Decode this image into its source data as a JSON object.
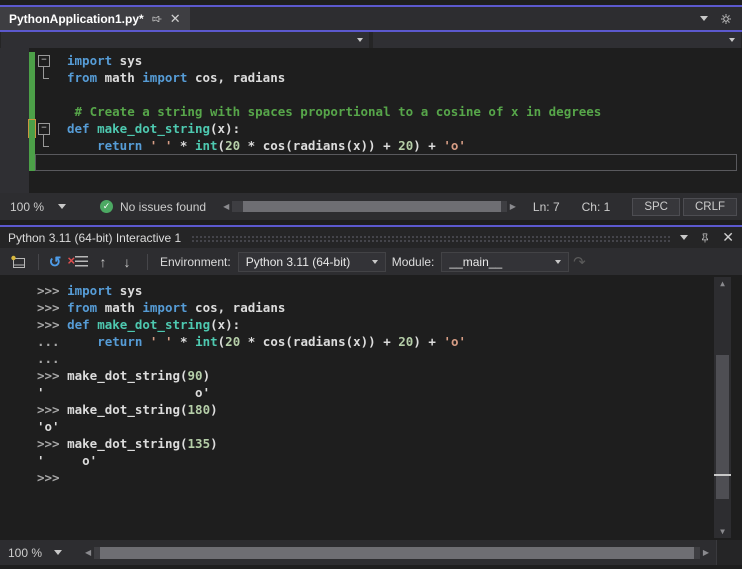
{
  "colors": {
    "accent": "#5C59CE",
    "keyword_blue": "#569CD6",
    "string_orange": "#D69D85",
    "number_green": "#B5CEA8",
    "comment_green": "#57A64A",
    "type_teal": "#4EC9B0",
    "change_bar_green": "#4CA048",
    "reset_icon_blue": "#4E9CE8"
  },
  "tab_strip": {
    "active_tab": "PythonApplication1.py*"
  },
  "editor_status": {
    "zoom_level": "100 %",
    "issues_status": "No issues found",
    "line": "Ln: 7",
    "column": "Ch: 1",
    "indent_mode": "SPC",
    "line_ending": "CRLF"
  },
  "panel": {
    "title": "Python 3.11 (64-bit) Interactive 1",
    "toolbar": {
      "environment_label": "Environment:",
      "environment_value": "Python 3.11 (64-bit)",
      "module_label": "Module:",
      "module_value": "__main__"
    },
    "status": {
      "zoom_level": "100 %"
    }
  },
  "editor_code": {
    "lines": [
      {
        "fold": "minus",
        "change": true,
        "tokens": [
          {
            "t": "import",
            "c": "kw"
          },
          {
            "t": " sys",
            "c": "pl"
          }
        ]
      },
      {
        "fold": "end",
        "change": true,
        "tokens": [
          {
            "t": "from",
            "c": "kw"
          },
          {
            "t": " math ",
            "c": "pl"
          },
          {
            "t": "import",
            "c": "kw"
          },
          {
            "t": " cos, radians",
            "c": "pl"
          }
        ]
      },
      {
        "fold": "",
        "change": true,
        "tokens": []
      },
      {
        "fold": "",
        "change": true,
        "tokens": [
          {
            "t": " # Create a string with spaces proportional to a cosine of x in degrees",
            "c": "com"
          }
        ]
      },
      {
        "fold": "minus",
        "change": true,
        "mark": true,
        "tokens": [
          {
            "t": "def",
            "c": "kw"
          },
          {
            "t": " ",
            "c": "pl"
          },
          {
            "t": "make_dot_string",
            "c": "fn"
          },
          {
            "t": "(x):",
            "c": "pl"
          }
        ]
      },
      {
        "fold": "end",
        "change": true,
        "tokens": [
          {
            "t": "    ",
            "c": "pl"
          },
          {
            "t": "return",
            "c": "kw"
          },
          {
            "t": " ",
            "c": "pl"
          },
          {
            "t": "' '",
            "c": "str"
          },
          {
            "t": " * ",
            "c": "pl"
          },
          {
            "t": "int",
            "c": "fn"
          },
          {
            "t": "(",
            "c": "pl"
          },
          {
            "t": "20",
            "c": "num"
          },
          {
            "t": " * cos(radians(x)) + ",
            "c": "pl"
          },
          {
            "t": "20",
            "c": "num"
          },
          {
            "t": ") + ",
            "c": "pl"
          },
          {
            "t": "'o'",
            "c": "str"
          }
        ]
      },
      {
        "fold": "",
        "change": true,
        "caret": true,
        "tokens": []
      }
    ]
  },
  "repl_code": {
    "lines": [
      {
        "tokens": [
          {
            "t": ">>> ",
            "c": "pr"
          },
          {
            "t": "import",
            "c": "kw"
          },
          {
            "t": " sys",
            "c": "pl"
          }
        ]
      },
      {
        "tokens": [
          {
            "t": ">>> ",
            "c": "pr"
          },
          {
            "t": "from",
            "c": "kw"
          },
          {
            "t": " math ",
            "c": "pl"
          },
          {
            "t": "import",
            "c": "kw"
          },
          {
            "t": " cos, radians",
            "c": "pl"
          }
        ]
      },
      {
        "tokens": [
          {
            "t": ">>> ",
            "c": "pr"
          },
          {
            "t": "def",
            "c": "kw"
          },
          {
            "t": " ",
            "c": "pl"
          },
          {
            "t": "make_dot_string",
            "c": "fn"
          },
          {
            "t": "(x):",
            "c": "pl"
          }
        ]
      },
      {
        "tokens": [
          {
            "t": "... ",
            "c": "pr"
          },
          {
            "t": "    ",
            "c": "pl"
          },
          {
            "t": "return",
            "c": "kw"
          },
          {
            "t": " ",
            "c": "pl"
          },
          {
            "t": "' '",
            "c": "str"
          },
          {
            "t": " * ",
            "c": "pl"
          },
          {
            "t": "int",
            "c": "fn"
          },
          {
            "t": "(",
            "c": "pl"
          },
          {
            "t": "20",
            "c": "num"
          },
          {
            "t": " * cos(radians(x)) + ",
            "c": "pl"
          },
          {
            "t": "20",
            "c": "num"
          },
          {
            "t": ") + ",
            "c": "pl"
          },
          {
            "t": "'o'",
            "c": "str"
          }
        ]
      },
      {
        "tokens": [
          {
            "t": "...",
            "c": "pr"
          }
        ]
      },
      {
        "tokens": [
          {
            "t": ">>> ",
            "c": "pr"
          },
          {
            "t": "make_dot_string(",
            "c": "pl"
          },
          {
            "t": "90",
            "c": "num"
          },
          {
            "t": ")",
            "c": "pl"
          }
        ]
      },
      {
        "tokens": [
          {
            "t": "'                    o'",
            "c": "pl"
          }
        ]
      },
      {
        "tokens": [
          {
            "t": ">>> ",
            "c": "pr"
          },
          {
            "t": "make_dot_string(",
            "c": "pl"
          },
          {
            "t": "180",
            "c": "num"
          },
          {
            "t": ")",
            "c": "pl"
          }
        ]
      },
      {
        "tokens": [
          {
            "t": "'o'",
            "c": "pl"
          }
        ]
      },
      {
        "tokens": [
          {
            "t": ">>> ",
            "c": "pr"
          },
          {
            "t": "make_dot_string(",
            "c": "pl"
          },
          {
            "t": "135",
            "c": "num"
          },
          {
            "t": ")",
            "c": "pl"
          }
        ]
      },
      {
        "tokens": [
          {
            "t": "'     o'",
            "c": "pl"
          }
        ]
      },
      {
        "tokens": [
          {
            "t": ">>>",
            "c": "pr"
          }
        ]
      }
    ]
  }
}
